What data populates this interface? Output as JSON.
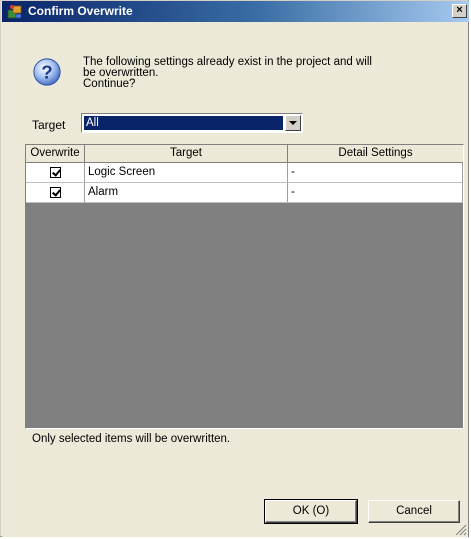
{
  "window": {
    "title": "Confirm Overwrite",
    "close_label": "×"
  },
  "message": {
    "line1": "The following settings already exist in the project and will",
    "line2": "be overwritten.",
    "line3": "Continue?"
  },
  "target": {
    "label": "Target",
    "selected": "All"
  },
  "table": {
    "columns": [
      "Overwrite",
      "Target",
      "Detail Settings"
    ],
    "rows": [
      {
        "checked": true,
        "target": "Logic Screen",
        "detail": "-"
      },
      {
        "checked": true,
        "target": "Alarm",
        "detail": "-"
      }
    ]
  },
  "note": "Only selected items will be overwritten.",
  "buttons": {
    "ok": "OK (O)",
    "cancel": "Cancel"
  },
  "colors": {
    "selection": "#0a246a",
    "dialog_bg": "#ece9d8",
    "grid_empty": "#808080"
  },
  "icons": [
    "settings-icon",
    "question-icon",
    "chevron-down-icon",
    "check-icon",
    "resize-grip-icon"
  ]
}
